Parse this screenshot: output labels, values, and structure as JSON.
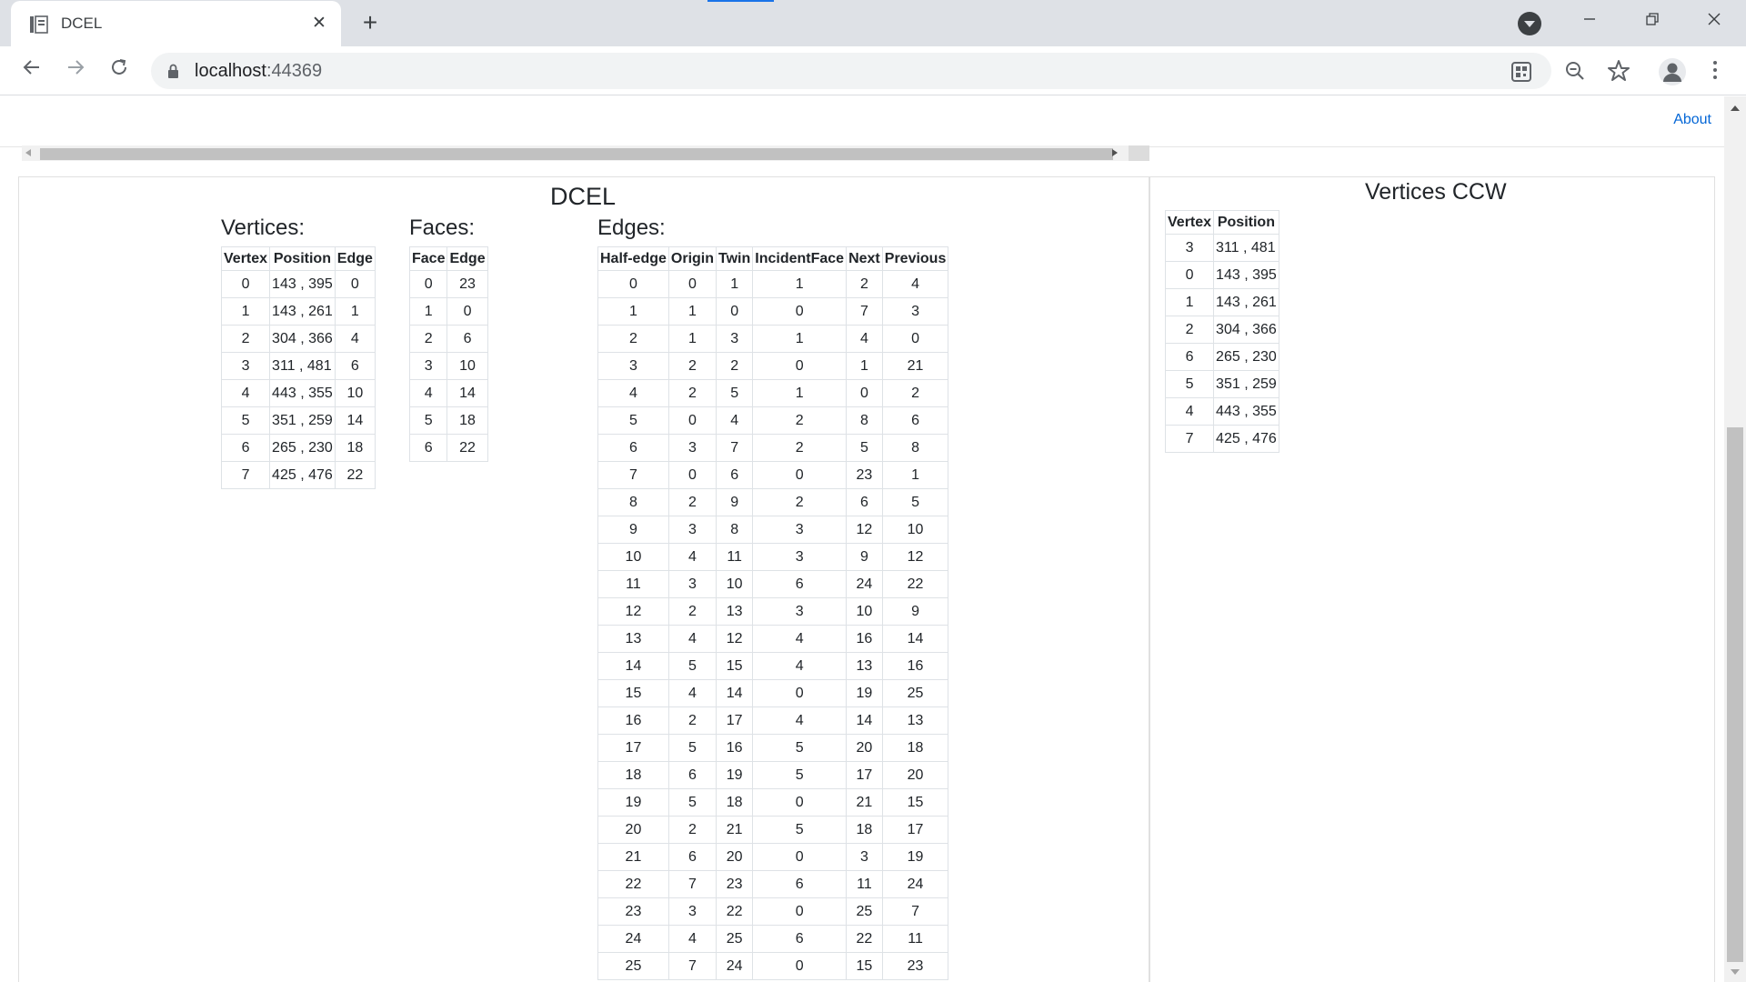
{
  "browser": {
    "tab_title": "DCEL",
    "url_host": "localhost",
    "url_port": ":44369"
  },
  "nav": {
    "about": "About"
  },
  "dcel": {
    "title": "DCEL",
    "vertices": {
      "heading": "Vertices:",
      "columns": [
        "Vertex",
        "Position",
        "Edge"
      ],
      "rows": [
        [
          "0",
          "143 , 395",
          "0"
        ],
        [
          "1",
          "143 , 261",
          "1"
        ],
        [
          "2",
          "304 , 366",
          "4"
        ],
        [
          "3",
          "311 , 481",
          "6"
        ],
        [
          "4",
          "443 , 355",
          "10"
        ],
        [
          "5",
          "351 , 259",
          "14"
        ],
        [
          "6",
          "265 , 230",
          "18"
        ],
        [
          "7",
          "425 , 476",
          "22"
        ]
      ]
    },
    "faces": {
      "heading": "Faces:",
      "columns": [
        "Face",
        "Edge"
      ],
      "rows": [
        [
          "0",
          "23"
        ],
        [
          "1",
          "0"
        ],
        [
          "2",
          "6"
        ],
        [
          "3",
          "10"
        ],
        [
          "4",
          "14"
        ],
        [
          "5",
          "18"
        ],
        [
          "6",
          "22"
        ]
      ]
    },
    "edges": {
      "heading": "Edges:",
      "columns": [
        "Half-edge",
        "Origin",
        "Twin",
        "IncidentFace",
        "Next",
        "Previous"
      ],
      "rows": [
        [
          "0",
          "0",
          "1",
          "1",
          "2",
          "4"
        ],
        [
          "1",
          "1",
          "0",
          "0",
          "7",
          "3"
        ],
        [
          "2",
          "1",
          "3",
          "1",
          "4",
          "0"
        ],
        [
          "3",
          "2",
          "2",
          "0",
          "1",
          "21"
        ],
        [
          "4",
          "2",
          "5",
          "1",
          "0",
          "2"
        ],
        [
          "5",
          "0",
          "4",
          "2",
          "8",
          "6"
        ],
        [
          "6",
          "3",
          "7",
          "2",
          "5",
          "8"
        ],
        [
          "7",
          "0",
          "6",
          "0",
          "23",
          "1"
        ],
        [
          "8",
          "2",
          "9",
          "2",
          "6",
          "5"
        ],
        [
          "9",
          "3",
          "8",
          "3",
          "12",
          "10"
        ],
        [
          "10",
          "4",
          "11",
          "3",
          "9",
          "12"
        ],
        [
          "11",
          "3",
          "10",
          "6",
          "24",
          "22"
        ],
        [
          "12",
          "2",
          "13",
          "3",
          "10",
          "9"
        ],
        [
          "13",
          "4",
          "12",
          "4",
          "16",
          "14"
        ],
        [
          "14",
          "5",
          "15",
          "4",
          "13",
          "16"
        ],
        [
          "15",
          "4",
          "14",
          "0",
          "19",
          "25"
        ],
        [
          "16",
          "2",
          "17",
          "4",
          "14",
          "13"
        ],
        [
          "17",
          "5",
          "16",
          "5",
          "20",
          "18"
        ],
        [
          "18",
          "6",
          "19",
          "5",
          "17",
          "20"
        ],
        [
          "19",
          "5",
          "18",
          "0",
          "21",
          "15"
        ],
        [
          "20",
          "2",
          "21",
          "5",
          "18",
          "17"
        ],
        [
          "21",
          "6",
          "20",
          "0",
          "3",
          "19"
        ],
        [
          "22",
          "7",
          "23",
          "6",
          "11",
          "24"
        ],
        [
          "23",
          "3",
          "22",
          "0",
          "25",
          "7"
        ],
        [
          "24",
          "4",
          "25",
          "6",
          "22",
          "11"
        ],
        [
          "25",
          "7",
          "24",
          "0",
          "15",
          "23"
        ]
      ]
    }
  },
  "ccw": {
    "title": "Vertices CCW",
    "columns": [
      "Vertex",
      "Position"
    ],
    "rows": [
      [
        "3",
        "311 , 481"
      ],
      [
        "0",
        "143 , 395"
      ],
      [
        "1",
        "143 , 261"
      ],
      [
        "2",
        "304 , 366"
      ],
      [
        "6",
        "265 , 230"
      ],
      [
        "5",
        "351 , 259"
      ],
      [
        "4",
        "443 , 355"
      ],
      [
        "7",
        "425 , 476"
      ]
    ]
  }
}
